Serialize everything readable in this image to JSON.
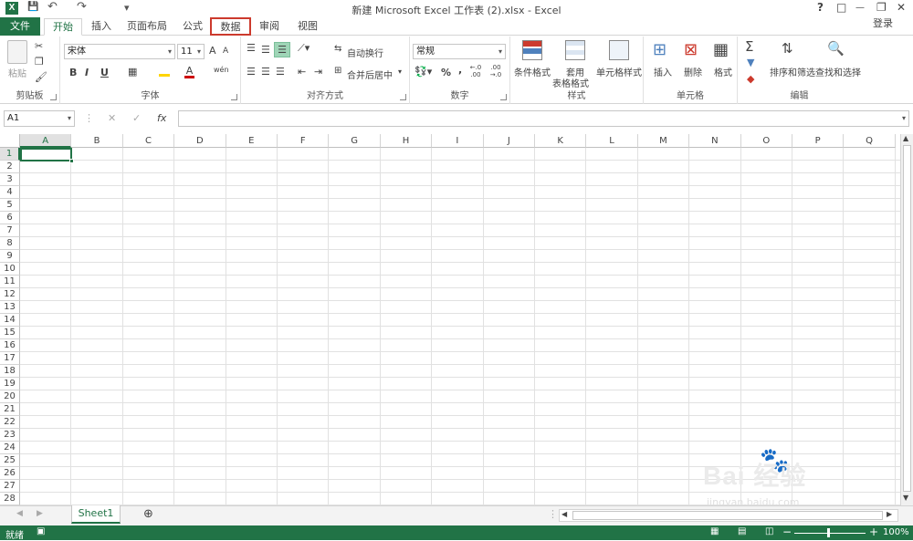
{
  "title": "新建 Microsoft Excel 工作表 (2).xlsx - Excel",
  "window": {
    "help": "?",
    "restore": "□",
    "minimize": "—",
    "maximize": "❐",
    "close": "✕"
  },
  "qat": {
    "save": "💾",
    "undo": "↶",
    "redo": "↷",
    "customize": "▾"
  },
  "login": "登录",
  "tabs": {
    "file": "文件",
    "home": "开始",
    "insert": "插入",
    "layout": "页面布局",
    "formulas": "公式",
    "data": "数据",
    "review": "审阅",
    "view": "视图"
  },
  "ribbon": {
    "clipboard": {
      "label": "剪贴板",
      "paste": "粘贴"
    },
    "font": {
      "label": "字体",
      "name": "宋体",
      "size": "11",
      "bold": "B",
      "italic": "I",
      "underline": "U",
      "grow": "A",
      "shrink": "A",
      "fontcolor": "A",
      "phonetic": "wén"
    },
    "align": {
      "label": "对齐方式",
      "wrap": "自动换行",
      "merge": "合并后居中"
    },
    "number": {
      "label": "数字",
      "format": "常规",
      "percent": "%",
      "comma": ",",
      "inc": "←.0 .00",
      "dec": ".00 →.0"
    },
    "styles": {
      "label": "样式",
      "cond": "条件格式",
      "table1": "套用",
      "table2": "表格格式",
      "cell": "单元格样式"
    },
    "cells": {
      "label": "单元格",
      "insert": "插入",
      "delete": "删除",
      "format": "格式"
    },
    "editing": {
      "label": "编辑",
      "sortfilter": "排序和筛选",
      "findselect": "查找和选择",
      "sum": "Σ"
    }
  },
  "formula_bar": {
    "namebox": "A1",
    "cancel": "✕",
    "enter": "✓",
    "fx": "fx",
    "value": ""
  },
  "columns": [
    "A",
    "B",
    "C",
    "D",
    "E",
    "F",
    "G",
    "H",
    "I",
    "J",
    "K",
    "L",
    "M",
    "N",
    "O",
    "P",
    "Q"
  ],
  "rows": [
    "1",
    "2",
    "3",
    "4",
    "5",
    "6",
    "7",
    "8",
    "9",
    "10",
    "11",
    "12",
    "13",
    "14",
    "15",
    "16",
    "17",
    "18",
    "19",
    "20",
    "21",
    "22",
    "23",
    "24",
    "25",
    "26",
    "27",
    "28"
  ],
  "sheets": [
    "Sheet1"
  ],
  "status": {
    "ready": "就绪",
    "zoom": "100%"
  },
  "watermark": {
    "text": "Bai 经验",
    "url": "jingyan.baidu.com"
  }
}
